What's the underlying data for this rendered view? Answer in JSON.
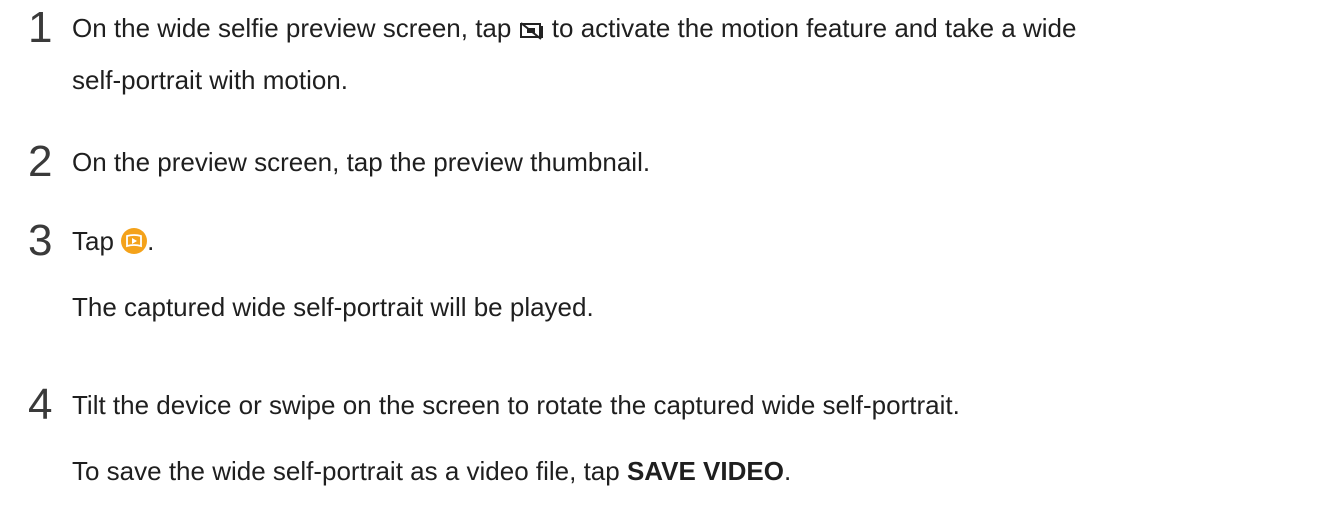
{
  "steps": [
    {
      "number": "1",
      "line1_before": "On the wide selfie preview screen, tap ",
      "line1_after": " to activate the motion feature and take a wide",
      "line1_icon": "motion-toggle-icon",
      "line2": "self-portrait with motion."
    },
    {
      "number": "2",
      "text": "On the preview screen, tap the preview thumbnail."
    },
    {
      "number": "3",
      "before": "Tap ",
      "after": ".",
      "icon": "play-panorama-icon",
      "icon_color": "#f4a21a",
      "result": "The captured wide self-portrait will be played."
    },
    {
      "number": "4",
      "text": "Tilt the device or swipe on the screen to rotate the captured wide self-portrait.",
      "note_before": "To save the wide self-portrait as a video file, tap ",
      "note_bold": "SAVE VIDEO",
      "note_after": "."
    }
  ]
}
